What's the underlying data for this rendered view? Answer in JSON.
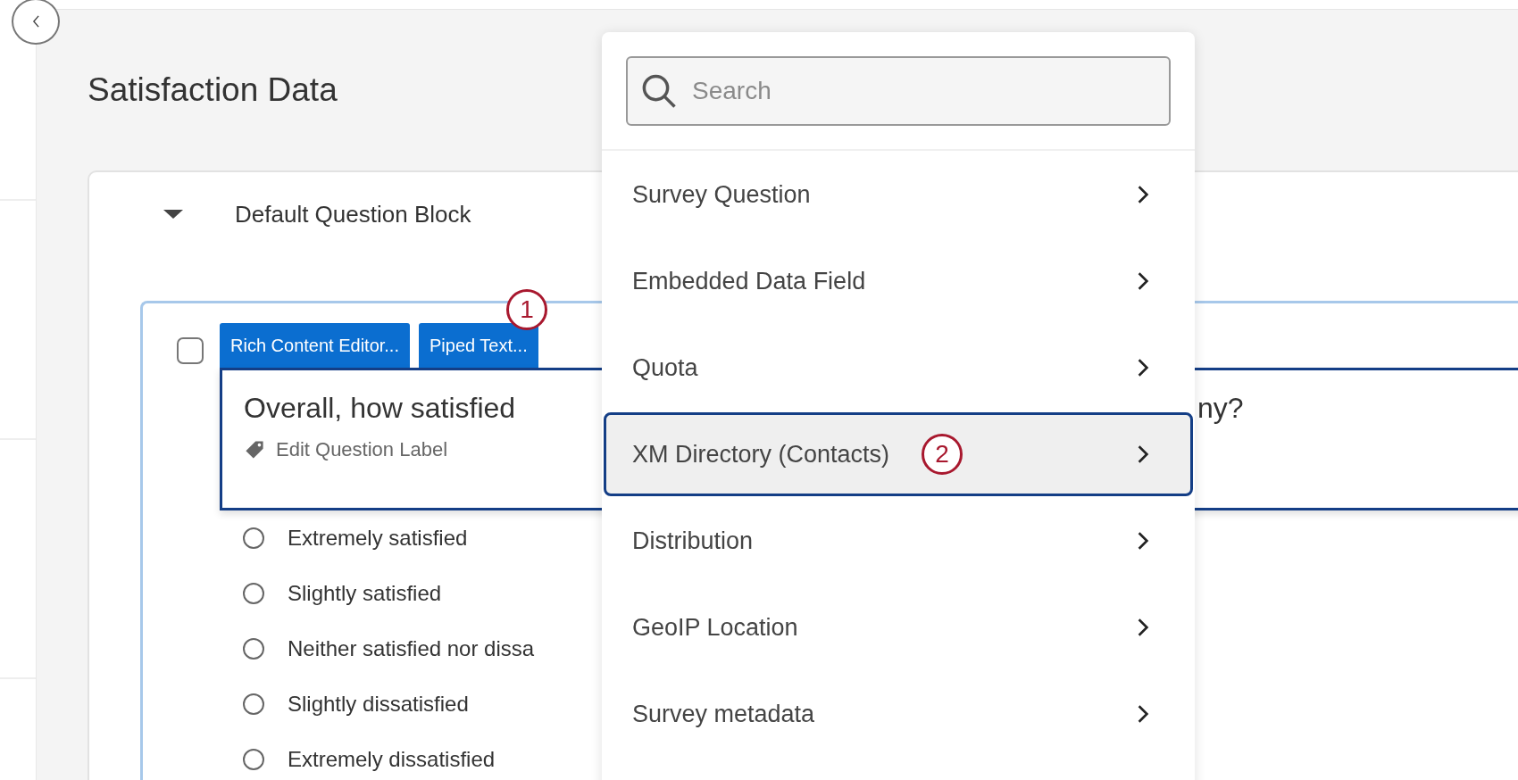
{
  "page_title": "Satisfaction Data",
  "block": {
    "title": "Default Question Block",
    "expanded": true
  },
  "question": {
    "checked": false,
    "callout": "1",
    "tabs": [
      "Rich Content Editor...",
      "Piped Text..."
    ],
    "text_start": "Overall, how satisfied",
    "text_end": "ny?",
    "label_link": "Edit Question Label",
    "options": [
      {
        "label": "Extremely satisfied",
        "selected": false
      },
      {
        "label": "Slightly satisfied",
        "selected": false
      },
      {
        "label": "Neither satisfied nor dissa",
        "selected": false
      },
      {
        "label": "Slightly dissatisfied",
        "selected": false
      },
      {
        "label": "Extremely dissatisfied",
        "selected": false
      }
    ]
  },
  "menu": {
    "search": {
      "placeholder": "Search"
    },
    "items": [
      {
        "label": "Survey Question",
        "selected": false
      },
      {
        "label": "Embedded Data Field",
        "selected": false
      },
      {
        "label": "Quota",
        "selected": false
      },
      {
        "label": "XM Directory (Contacts)",
        "selected": true,
        "callout": "2"
      },
      {
        "label": "Distribution",
        "selected": false
      },
      {
        "label": "GeoIP Location",
        "selected": false
      },
      {
        "label": "Survey metadata",
        "selected": false
      }
    ]
  }
}
